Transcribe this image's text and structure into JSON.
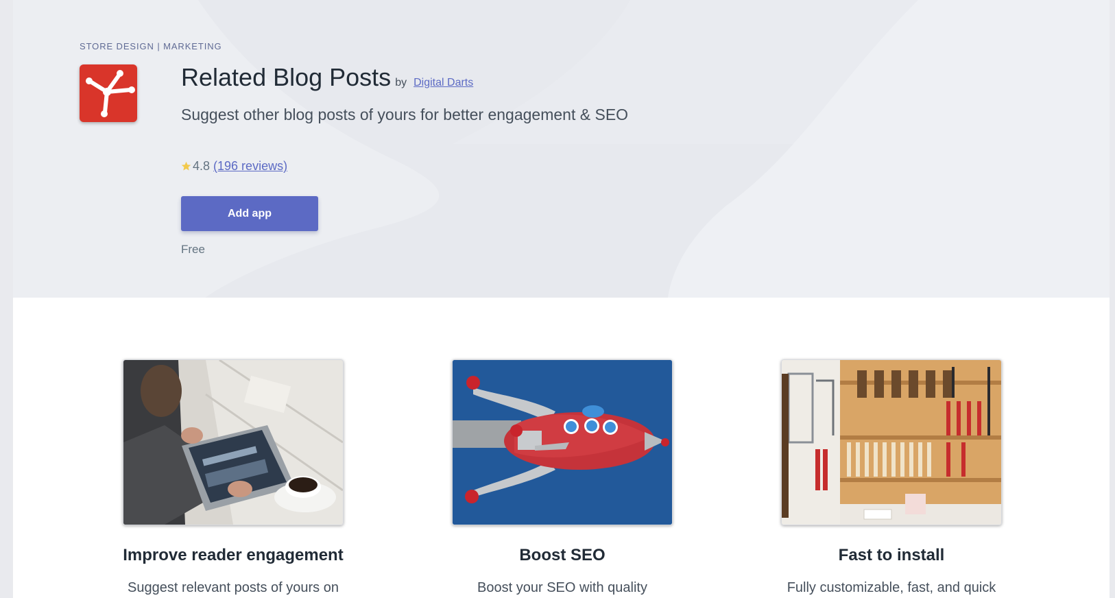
{
  "header": {
    "categories": [
      "STORE DESIGN",
      "MARKETING"
    ],
    "category_separator": " | ",
    "app_icon": "network-nodes-icon",
    "brand_color": "#d9352a",
    "title": "Related Blog Posts",
    "by_label": "by",
    "developer": "Digital Darts",
    "tagline": "Suggest other blog posts of yours for better engagement & SEO",
    "rating": "4.8",
    "reviews_label": "(196 reviews)",
    "add_button_label": "Add app",
    "accent_color": "#5c6ac4",
    "price": "Free"
  },
  "features": [
    {
      "image": "person-with-tablet-and-coffee-photo",
      "title": "Improve reader engagement",
      "description": "Suggest relevant posts of yours on"
    },
    {
      "image": "red-rocket-sculpture-photo",
      "title": "Boost SEO",
      "description": "Boost your SEO with quality"
    },
    {
      "image": "tool-wall-workshop-photo",
      "title": "Fast to install",
      "description": "Fully customizable, fast, and quick"
    }
  ]
}
